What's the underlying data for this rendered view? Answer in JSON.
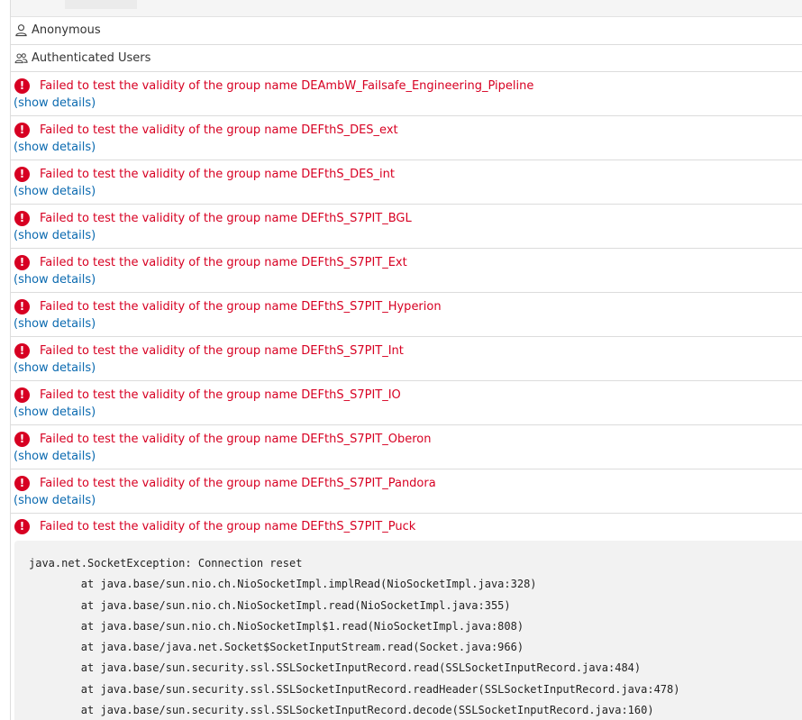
{
  "users": [
    {
      "label": "Anonymous",
      "icon": "user-icon"
    },
    {
      "label": "Authenticated Users",
      "icon": "users-icon"
    }
  ],
  "errors": [
    {
      "message": "Failed to test the validity of the group name DEAmbW_Failsafe_Engineering_Pipeline",
      "link": "(show details)"
    },
    {
      "message": "Failed to test the validity of the group name DEFthS_DES_ext",
      "link": "(show details)"
    },
    {
      "message": "Failed to test the validity of the group name DEFthS_DES_int",
      "link": "(show details)"
    },
    {
      "message": "Failed to test the validity of the group name DEFthS_S7PIT_BGL",
      "link": "(show details)"
    },
    {
      "message": "Failed to test the validity of the group name DEFthS_S7PIT_Ext",
      "link": "(show details)"
    },
    {
      "message": "Failed to test the validity of the group name DEFthS_S7PIT_Hyperion",
      "link": "(show details)"
    },
    {
      "message": "Failed to test the validity of the group name DEFthS_S7PIT_Int",
      "link": "(show details)"
    },
    {
      "message": "Failed to test the validity of the group name DEFthS_S7PIT_IO",
      "link": "(show details)"
    },
    {
      "message": "Failed to test the validity of the group name DEFthS_S7PIT_Oberon",
      "link": "(show details)"
    },
    {
      "message": "Failed to test the validity of the group name DEFthS_S7PIT_Pandora",
      "link": "(show details)"
    }
  ],
  "expanded_error": {
    "message": "Failed to test the validity of the group name DEFthS_S7PIT_Puck",
    "stack_trace": [
      "java.net.SocketException: Connection reset",
      "        at java.base/sun.nio.ch.NioSocketImpl.implRead(NioSocketImpl.java:328)",
      "        at java.base/sun.nio.ch.NioSocketImpl.read(NioSocketImpl.java:355)",
      "        at java.base/sun.nio.ch.NioSocketImpl$1.read(NioSocketImpl.java:808)",
      "        at java.base/java.net.Socket$SocketInputStream.read(Socket.java:966)",
      "        at java.base/sun.security.ssl.SSLSocketInputRecord.read(SSLSocketInputRecord.java:484)",
      "        at java.base/sun.security.ssl.SSLSocketInputRecord.readHeader(SSLSocketInputRecord.java:478)",
      "        at java.base/sun.security.ssl.SSLSocketInputRecord.decode(SSLSocketInputRecord.java:160)"
    ]
  },
  "colors": {
    "error": "#d70022",
    "link": "#0b6ab0",
    "stack_bg": "#f2f2f2"
  },
  "icons": {
    "error": "exclamation-circle-icon",
    "error_glyph": "!"
  }
}
